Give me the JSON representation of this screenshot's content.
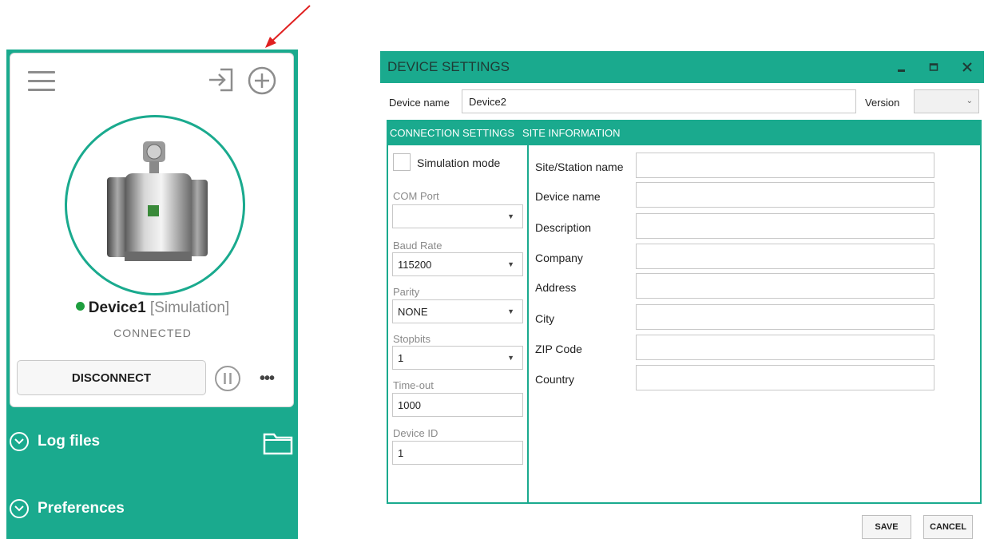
{
  "colors": {
    "accent": "#1aaa8e",
    "status_connected": "#1e9e3e",
    "arrow": "#e02020"
  },
  "device_panel": {
    "device_name": "Device1",
    "device_mode": "[Simulation]",
    "status": "CONNECTED",
    "disconnect_label": "DISCONNECT",
    "more_label": "•••",
    "sections": [
      "Log files",
      "Preferences"
    ]
  },
  "dialog": {
    "title": "DEVICE SETTINGS",
    "device_name_label": "Device name",
    "device_name_value": "Device2",
    "version_label": "Version",
    "tabs": [
      "CONNECTION SETTINGS",
      "SITE INFORMATION"
    ],
    "connection": {
      "simulation_label": "Simulation mode",
      "com_port_label": "COM Port",
      "com_port_value": "",
      "baud_label": "Baud Rate",
      "baud_value": "115200",
      "parity_label": "Parity",
      "parity_value": "NONE",
      "stopbits_label": "Stopbits",
      "stopbits_value": "1",
      "timeout_label": "Time-out",
      "timeout_value": "1000",
      "device_id_label": "Device ID",
      "device_id_value": "1"
    },
    "site_fields": [
      "Site/Station name",
      "Device name",
      "Description",
      "Company",
      "Address",
      "City",
      "ZIP Code",
      "Country"
    ],
    "save_label": "SAVE",
    "cancel_label": "CANCEL"
  }
}
